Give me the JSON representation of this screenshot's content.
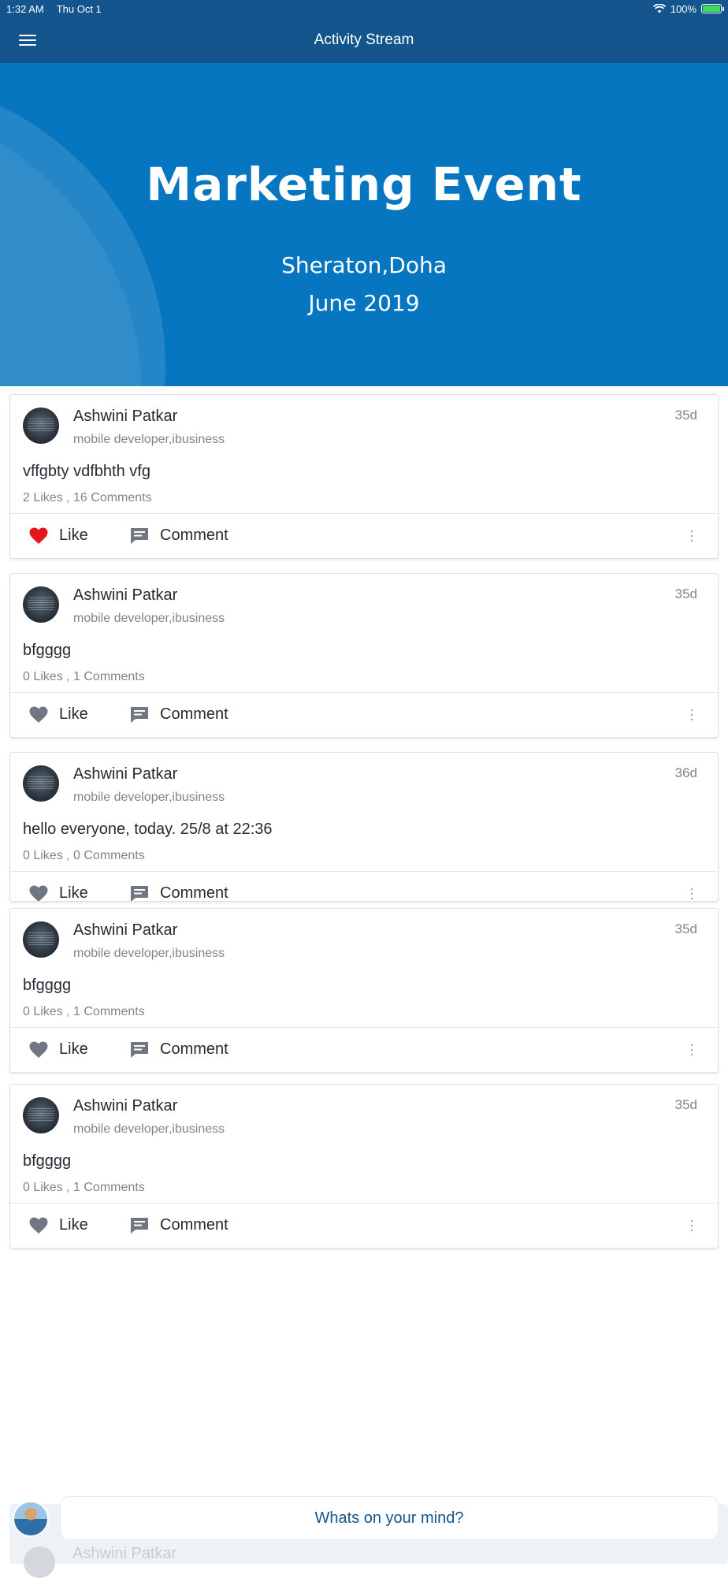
{
  "status_bar": {
    "time": "1:32 AM",
    "date": "Thu Oct 1",
    "battery": "100%",
    "wifi_icon": "wifi-icon"
  },
  "nav": {
    "title": "Activity Stream",
    "menu_icon": "menu-icon"
  },
  "banner": {
    "title": "Marketing Event",
    "location": "Sheraton,Doha",
    "date": "June 2019",
    "color": "#0676c0"
  },
  "accent_color": "#13558c",
  "liked_color": "#e8141c",
  "posts": [
    {
      "name": "Ashwini Patkar",
      "role": "mobile developer,ibusiness",
      "time": "35d",
      "text": "vffgbty vdfbhth vfg",
      "stats": "2 Likes , 16 Comments",
      "like_label": "Like",
      "comment_label": "Comment",
      "liked": true
    },
    {
      "name": "Ashwini Patkar",
      "role": "mobile developer,ibusiness",
      "time": "35d",
      "text": "bfgggg",
      "stats": "0 Likes , 1 Comments",
      "like_label": "Like",
      "comment_label": "Comment",
      "liked": false
    },
    {
      "name": "Ashwini Patkar",
      "role": "mobile developer,ibusiness",
      "time": "36d",
      "text": "hello everyone, today. 25/8 at 22:36",
      "stats": "0 Likes , 0 Comments",
      "like_label": "Like",
      "comment_label": "Comment",
      "liked": false
    },
    {
      "name": "Ashwini Patkar",
      "role": "mobile developer,ibusiness",
      "time": "35d",
      "text": "bfgggg",
      "stats": "0 Likes , 1 Comments",
      "like_label": "Like",
      "comment_label": "Comment",
      "liked": false
    },
    {
      "name": "Ashwini Patkar",
      "role": "mobile developer,ibusiness",
      "time": "35d",
      "text": "bfgggg",
      "stats": "0 Likes , 1 Comments",
      "like_label": "Like",
      "comment_label": "Comment",
      "liked": false
    }
  ],
  "compose": {
    "placeholder": "Whats on your mind?",
    "ghost_name": "Ashwini Patkar"
  }
}
